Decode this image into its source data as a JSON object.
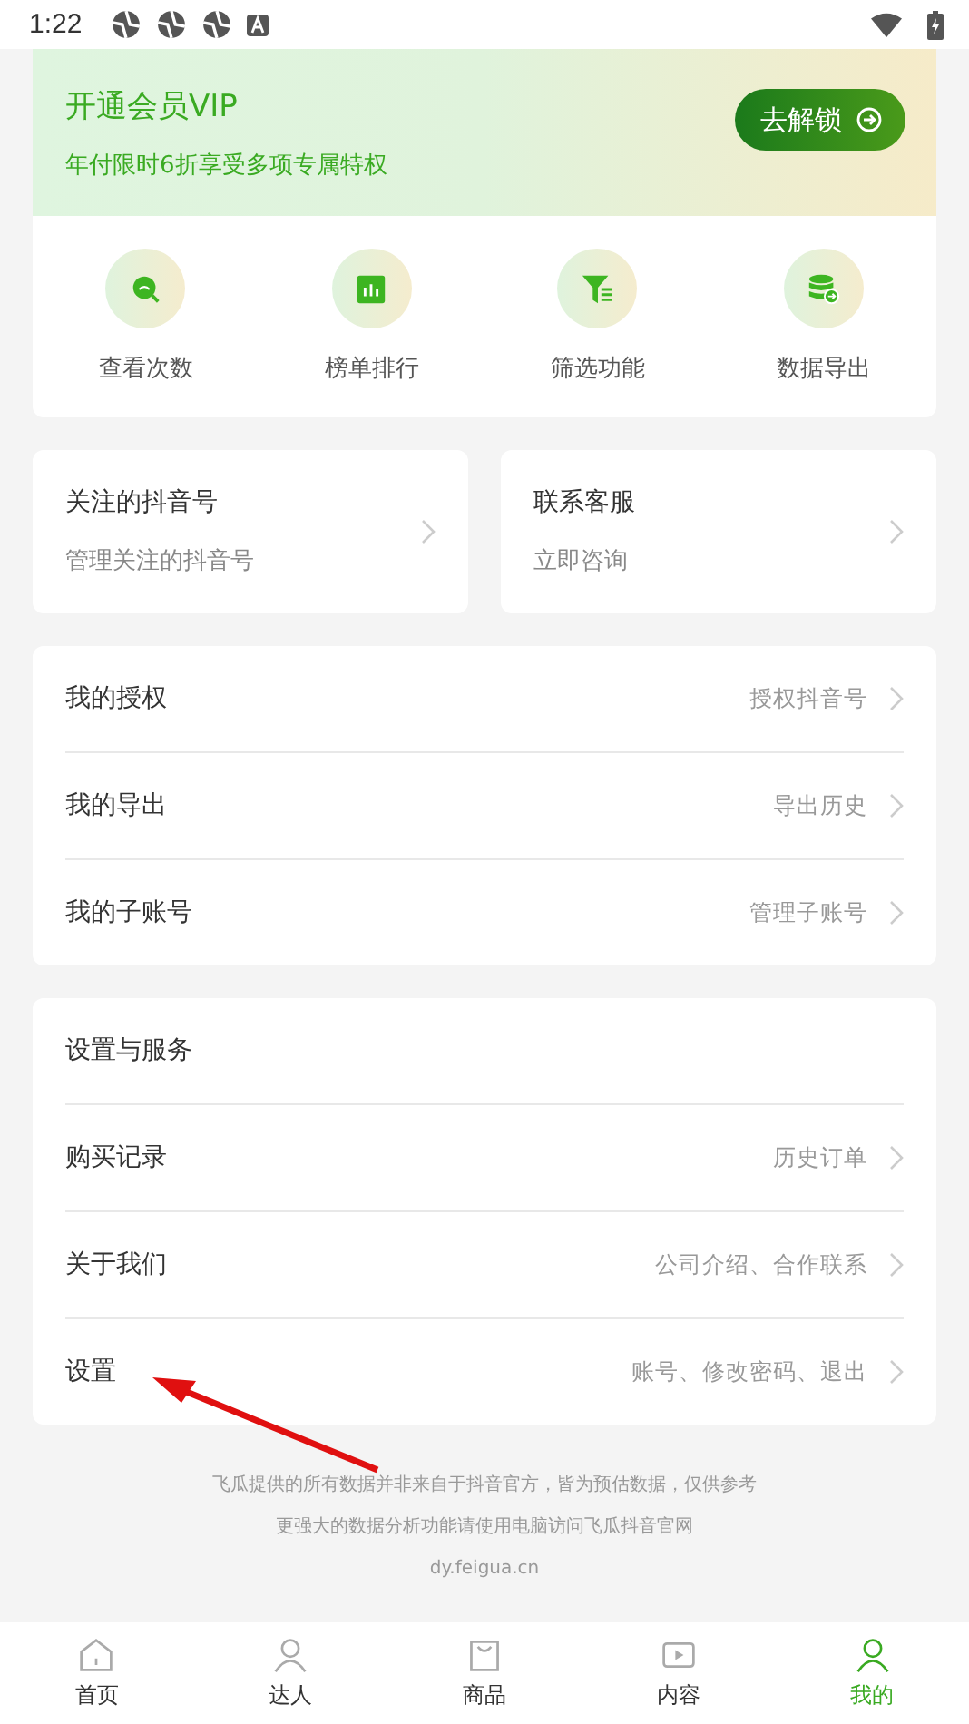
{
  "status_bar": {
    "time": "1:22",
    "notification_icons": [
      {
        "kind": "app"
      },
      {
        "kind": "app"
      },
      {
        "kind": "app"
      },
      {
        "kind": "letter"
      }
    ]
  },
  "vip_banner": {
    "title": "开通会员VIP",
    "subtitle": "年付限时6折享受多项专属特权",
    "button": "去解锁"
  },
  "features": [
    {
      "label": "查看次数",
      "kind": "search"
    },
    {
      "label": "榜单排行",
      "kind": "chart"
    },
    {
      "label": "筛选功能",
      "kind": "filter"
    },
    {
      "label": "数据导出",
      "kind": "export"
    }
  ],
  "quick_cards": [
    {
      "title": "关注的抖音号",
      "subtitle": "管理关注的抖音号"
    },
    {
      "title": "联系客服",
      "subtitle": "立即咨询"
    }
  ],
  "account_list": [
    {
      "label": "我的授权",
      "detail": "授权抖音号"
    },
    {
      "label": "我的导出",
      "detail": "导出历史"
    },
    {
      "label": "我的子账号",
      "detail": "管理子账号"
    }
  ],
  "settings_section": {
    "title": "设置与服务",
    "items": [
      {
        "label": "购买记录",
        "detail": "历史订单"
      },
      {
        "label": "关于我们",
        "detail": "公司介绍、合作联系"
      },
      {
        "label": "设置",
        "detail": "账号、修改密码、退出"
      }
    ]
  },
  "footer": [
    "飞瓜提供的所有数据并非来自于抖音官方，皆为预估数据，仅供参考",
    "更强大的数据分析功能请使用电脑访问飞瓜抖音官网",
    "dy.feigua.cn"
  ],
  "bottom_nav": [
    {
      "label": "首页",
      "kind": "home",
      "selected": false
    },
    {
      "label": "达人",
      "kind": "person",
      "selected": false
    },
    {
      "label": "商品",
      "kind": "bag",
      "selected": false
    },
    {
      "label": "内容",
      "kind": "play",
      "selected": false
    },
    {
      "label": "我的",
      "kind": "me",
      "selected": true
    }
  ]
}
